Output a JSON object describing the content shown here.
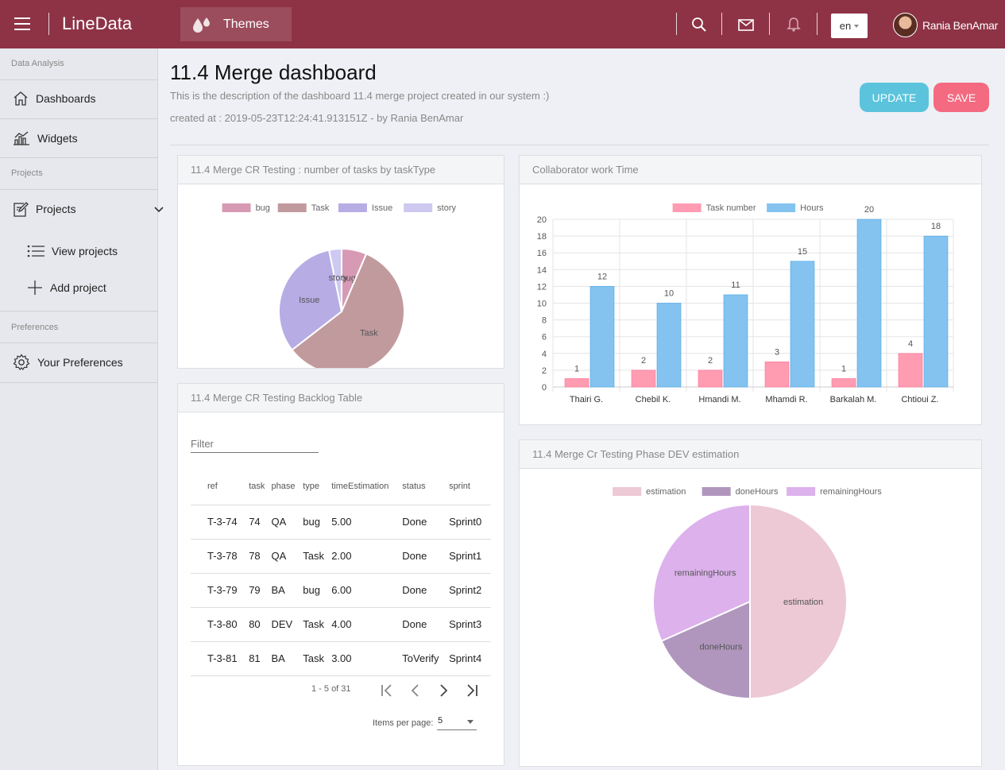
{
  "topbar": {
    "brand": "LineData",
    "themes_label": "Themes",
    "language": "en",
    "username": "Rania BenAmar",
    "color": "#8e3346"
  },
  "sidebar": {
    "sections": [
      "Data Analysis",
      "Projects",
      "Preferences"
    ],
    "items": {
      "dashboards": "Dashboards",
      "widgets": "Widgets",
      "projects": "Projects",
      "view_projects": "View projects",
      "add_project": "Add project",
      "preferences": "Your Preferences"
    }
  },
  "page": {
    "title": "11.4 Merge dashboard",
    "description": "This is the description of the dashboard 11.4 merge project created in our system :)",
    "created": "created at : 2019-05-23T12:24:41.913151Z - by Rania BenAmar",
    "update_label": "UPDATE",
    "save_label": "SAVE"
  },
  "cards": {
    "tasks_by_type": "11.4 Merge CR Testing : number of tasks by taskType",
    "work_time": "Collaborator work Time",
    "backlog": "11.4 Merge CR Testing Backlog Table",
    "phase_estimation": "11.4 Merge Cr Testing Phase DEV estimation"
  },
  "backlog": {
    "filter_label": "Filter",
    "columns": [
      "ref",
      "task",
      "phase",
      "type",
      "timeEstimation",
      "status",
      "sprint"
    ],
    "rows": [
      [
        "T-3-74",
        "74",
        "QA",
        "bug",
        "5.00",
        "Done",
        "Sprint0"
      ],
      [
        "T-3-78",
        "78",
        "QA",
        "Task",
        "2.00",
        "Done",
        "Sprint1"
      ],
      [
        "T-3-79",
        "79",
        "BA",
        "bug",
        "6.00",
        "Done",
        "Sprint2"
      ],
      [
        "T-3-80",
        "80",
        "DEV",
        "Task",
        "4.00",
        "Done",
        "Sprint3"
      ],
      [
        "T-3-81",
        "81",
        "BA",
        "Task",
        "3.00",
        "ToVerify",
        "Sprint4"
      ]
    ],
    "range": "1 - 5 of 31",
    "items_per_page_label": "Items per page:",
    "items_per_page": "5"
  },
  "chart_data": [
    {
      "type": "pie",
      "categories": [
        "bug",
        "Task",
        "Issue",
        "story"
      ],
      "values": [
        2,
        18,
        10,
        1
      ],
      "colors": [
        "#d79ab5",
        "#c19a9e",
        "#b7ace4",
        "#cdc9f0"
      ],
      "legend": "top"
    },
    {
      "type": "bar",
      "categories": [
        "Thairi G.",
        "Chebil K.",
        "Hmandi M.",
        "Mhamdi R.",
        "Barkalah M.",
        "Chtioui Z."
      ],
      "series": [
        {
          "name": "Task number",
          "values": [
            1,
            2,
            2,
            3,
            1,
            4
          ],
          "color": "#ff9cb2"
        },
        {
          "name": "Hours",
          "values": [
            12,
            10,
            11,
            15,
            20,
            18
          ],
          "color": "#84c3f0"
        }
      ],
      "ylim": [
        0,
        20
      ],
      "yticks": [
        0,
        2,
        4,
        6,
        8,
        10,
        12,
        14,
        16,
        18,
        20
      ],
      "grid": true,
      "legend": "top"
    },
    {
      "type": "pie",
      "categories": [
        "estimation",
        "doneHours",
        "remainingHours"
      ],
      "values": [
        30,
        11,
        19
      ],
      "colors": [
        "#ecc9d4",
        "#b096bd",
        "#dcb1ec"
      ],
      "legend": "top"
    }
  ]
}
